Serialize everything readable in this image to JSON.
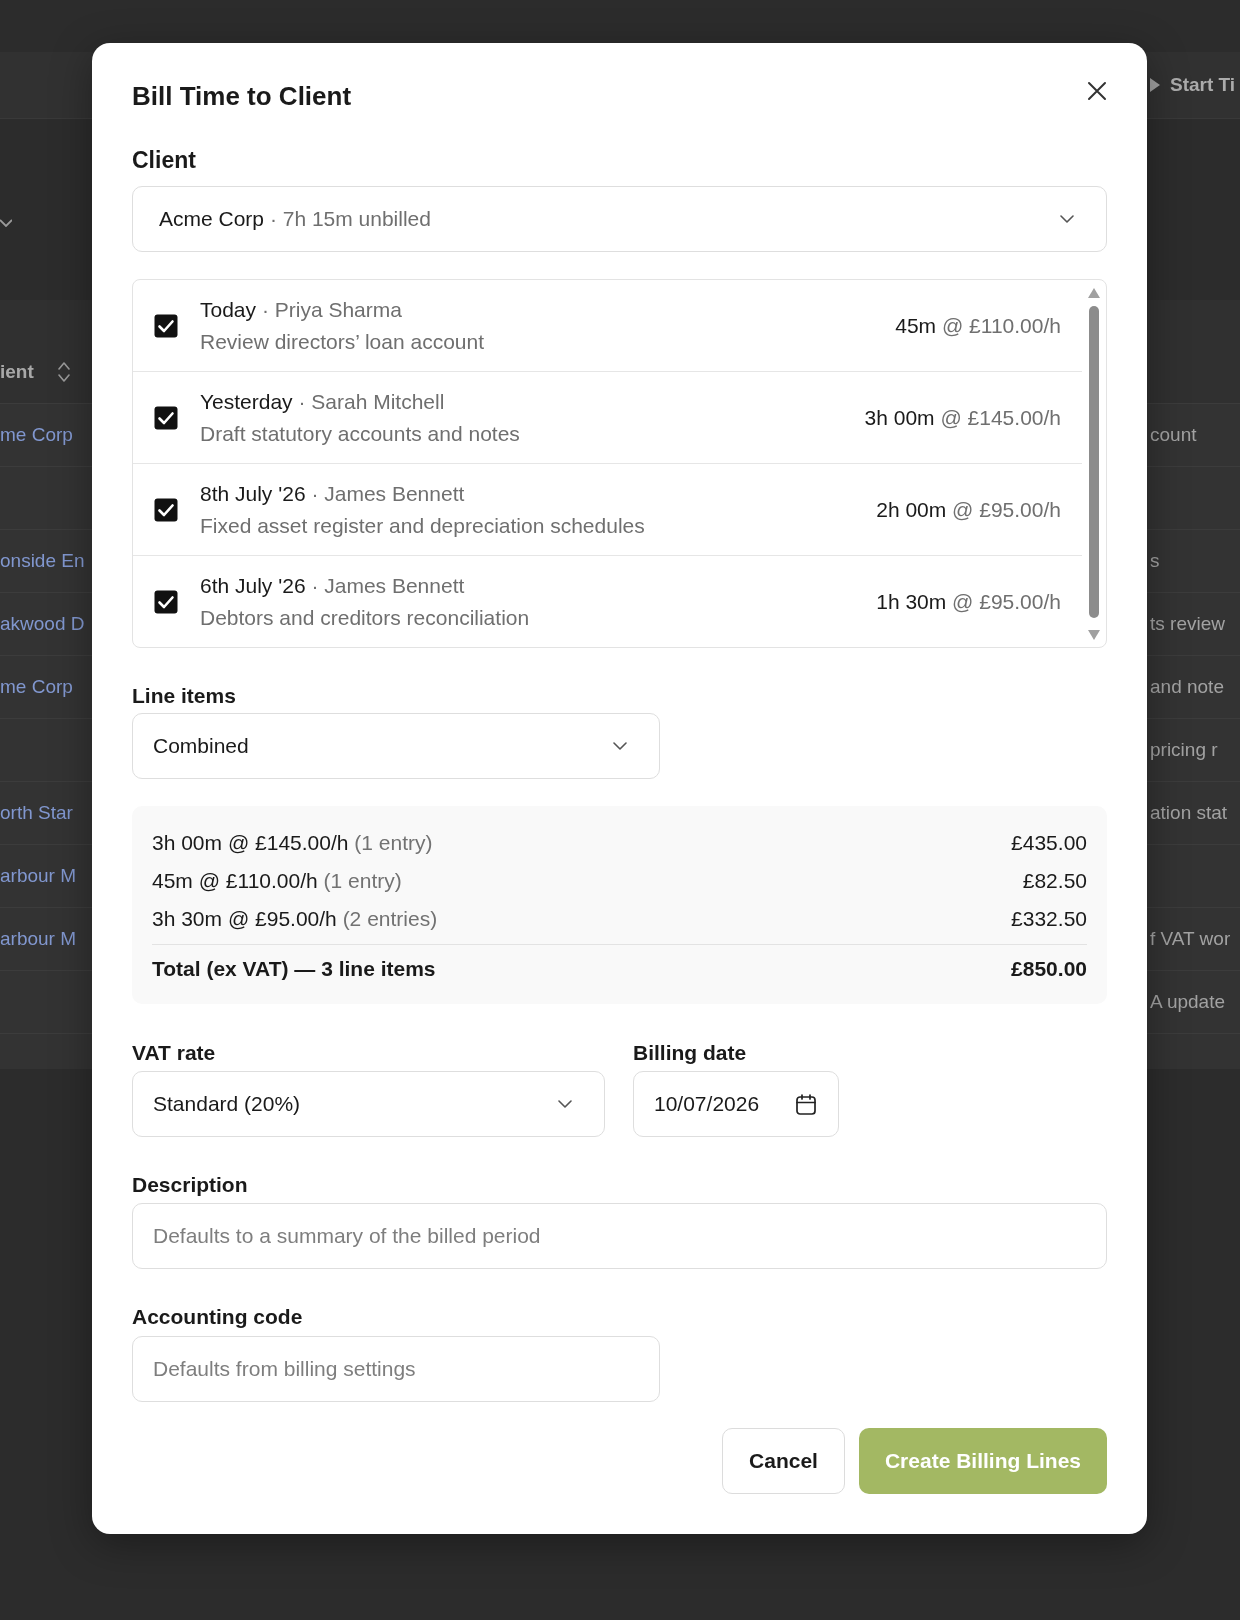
{
  "background": {
    "toolbar": {
      "button": "Start Ti"
    },
    "table": {
      "header": "ient",
      "rows": [
        {
          "left": "me Corp",
          "right": "count"
        },
        {},
        {
          "left": "onside En",
          "right": "s"
        },
        {
          "left": "akwood D",
          "right": "ts review"
        },
        {
          "left": "me Corp",
          "right": "and note"
        },
        {
          "right": "pricing r"
        },
        {
          "left": "orth Star",
          "right": "ation stat"
        },
        {
          "left": "arbour M"
        },
        {
          "left": "arbour M",
          "right": "f VAT wor"
        },
        {
          "right": "A update"
        }
      ]
    }
  },
  "dialog": {
    "title": "Bill Time to Client",
    "client": {
      "label": "Client",
      "value": "Acme Corp",
      "note": "· 7h 15m unbilled"
    },
    "entries": [
      {
        "checked": true,
        "date": "Today",
        "person": "· Priya Sharma",
        "description": "Review directors’ loan account",
        "duration": "45m",
        "rate": "@ £110.00/h"
      },
      {
        "checked": true,
        "date": "Yesterday",
        "person": "· Sarah Mitchell",
        "description": "Draft statutory accounts and notes",
        "duration": "3h 00m",
        "rate": "@ £145.00/h"
      },
      {
        "checked": true,
        "date": "8th July '26",
        "person": "· James Bennett",
        "description": "Fixed asset register and depreciation schedules",
        "duration": "2h 00m",
        "rate": "@ £95.00/h"
      },
      {
        "checked": true,
        "date": "6th July '26",
        "person": "· James Bennett",
        "description": "Debtors and creditors reconciliation",
        "duration": "1h 30m",
        "rate": "@ £95.00/h"
      }
    ],
    "line_items": {
      "label": "Line items",
      "value": "Combined"
    },
    "summary": {
      "lines": [
        {
          "text": "3h 00m @ £145.00/h",
          "note": "(1 entry)",
          "amount": "£435.00"
        },
        {
          "text": "45m @ £110.00/h",
          "note": "(1 entry)",
          "amount": "£82.50"
        },
        {
          "text": "3h 30m @ £95.00/h",
          "note": "(2 entries)",
          "amount": "£332.50"
        }
      ],
      "total": {
        "label": "Total (ex VAT) — 3 line items",
        "amount": "£850.00"
      }
    },
    "vat_rate": {
      "label": "VAT rate",
      "value": "Standard (20%)"
    },
    "billing_date": {
      "label": "Billing date",
      "value": "10/07/2026"
    },
    "description": {
      "label": "Description",
      "placeholder": "Defaults to a summary of the billed period"
    },
    "accounting_code": {
      "label": "Accounting code",
      "placeholder": "Defaults from billing settings"
    },
    "buttons": [
      {
        "label": "Cancel",
        "kind": "secondary"
      },
      {
        "label": "Create Billing Lines",
        "kind": "primary"
      }
    ]
  }
}
